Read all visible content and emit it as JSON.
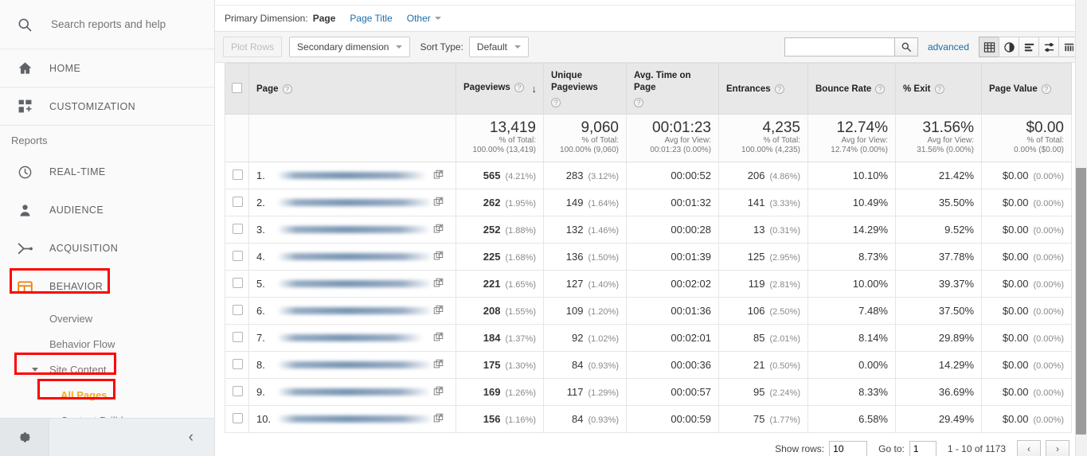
{
  "sidebar": {
    "search": {
      "placeholder": "Search reports and help",
      "value": "",
      "icon": "search-icon"
    },
    "items": [
      {
        "label": "HOME",
        "icon": "home-icon"
      },
      {
        "label": "CUSTOMIZATION",
        "icon": "customization-icon"
      }
    ],
    "section_title": "Reports",
    "reports": [
      {
        "label": "REAL-TIME",
        "icon": "clock-icon"
      },
      {
        "label": "AUDIENCE",
        "icon": "person-icon"
      },
      {
        "label": "ACQUISITION",
        "icon": "acquisition-icon"
      },
      {
        "label": "BEHAVIOR",
        "icon": "behavior-icon"
      }
    ],
    "behavior_subitems": [
      {
        "label": "Overview",
        "active": false,
        "expandable": false
      },
      {
        "label": "Behavior Flow",
        "active": false,
        "expandable": false
      },
      {
        "label": "Site Content",
        "active": false,
        "expandable": true
      },
      {
        "label": "All Pages",
        "active": true,
        "expandable": false,
        "indent": true
      },
      {
        "label": "Content Drilldown",
        "active": false,
        "expandable": false
      }
    ],
    "footer": {
      "gear_icon": "gear-icon",
      "collapse_icon": "chevron-left-icon"
    },
    "highlight_color": "#ff0000",
    "active_color": "#f9a825"
  },
  "primary_dimension": {
    "label": "Primary Dimension:",
    "active": "Page",
    "links": [
      "Page Title"
    ],
    "other": "Other"
  },
  "toolbar": {
    "plot_rows": "Plot Rows",
    "secondary_dimension": "Secondary dimension",
    "sort_type_label": "Sort Type:",
    "sort_type_value": "Default",
    "search_value": "",
    "search_icon": "search-icon",
    "advanced": "advanced",
    "views": [
      {
        "name": "table-view-icon",
        "active": true
      },
      {
        "name": "percentage-pie-view-icon",
        "active": false
      },
      {
        "name": "performance-bar-view-icon",
        "active": false
      },
      {
        "name": "comparison-view-icon",
        "active": false
      },
      {
        "name": "pivot-view-icon",
        "active": false
      }
    ]
  },
  "table": {
    "columns": [
      {
        "label": "Page",
        "help": true,
        "sorted": false
      },
      {
        "label": "Pageviews",
        "help": true,
        "sorted": true,
        "sort_dir": "↓"
      },
      {
        "label": "Unique Pageviews",
        "help": true,
        "sorted": false
      },
      {
        "label": "Avg. Time on Page",
        "help": true,
        "sorted": false
      },
      {
        "label": "Entrances",
        "help": true,
        "sorted": false
      },
      {
        "label": "Bounce Rate",
        "help": true,
        "sorted": false
      },
      {
        "label": "% Exit",
        "help": true,
        "sorted": false
      },
      {
        "label": "Page Value",
        "help": true,
        "sorted": false
      }
    ],
    "totals": [
      {
        "value": "13,419",
        "sub1": "% of Total:",
        "sub2": "100.00% (13,419)"
      },
      {
        "value": "9,060",
        "sub1": "% of Total:",
        "sub2": "100.00% (9,060)"
      },
      {
        "value": "00:01:23",
        "sub1": "Avg for View:",
        "sub2": "00:01:23 (0.00%)"
      },
      {
        "value": "4,235",
        "sub1": "% of Total:",
        "sub2": "100.00% (4,235)"
      },
      {
        "value": "12.74%",
        "sub1": "Avg for View:",
        "sub2": "12.74% (0.00%)"
      },
      {
        "value": "31.56%",
        "sub1": "Avg for View:",
        "sub2": "31.56% (0.00%)"
      },
      {
        "value": "$0.00",
        "sub1": "% of Total:",
        "sub2": "0.00% ($0.00)"
      }
    ],
    "rows": [
      {
        "rank": "1.",
        "page": "",
        "redacted": true,
        "pageviews": "565",
        "pageviews_pct": "(4.21%)",
        "unique": "283",
        "unique_pct": "(3.12%)",
        "avg_time": "00:00:52",
        "entrances": "206",
        "entrances_pct": "(4.86%)",
        "bounce": "10.10%",
        "exit": "21.42%",
        "value": "$0.00",
        "value_pct": "(0.00%)"
      },
      {
        "rank": "2.",
        "page": "",
        "redacted": true,
        "pageviews": "262",
        "pageviews_pct": "(1.95%)",
        "unique": "149",
        "unique_pct": "(1.64%)",
        "avg_time": "00:01:32",
        "entrances": "141",
        "entrances_pct": "(3.33%)",
        "bounce": "10.49%",
        "exit": "35.50%",
        "value": "$0.00",
        "value_pct": "(0.00%)"
      },
      {
        "rank": "3.",
        "page": "",
        "redacted": true,
        "pageviews": "252",
        "pageviews_pct": "(1.88%)",
        "unique": "132",
        "unique_pct": "(1.46%)",
        "avg_time": "00:00:28",
        "entrances": "13",
        "entrances_pct": "(0.31%)",
        "bounce": "14.29%",
        "exit": "9.52%",
        "value": "$0.00",
        "value_pct": "(0.00%)"
      },
      {
        "rank": "4.",
        "page": "",
        "redacted": true,
        "pageviews": "225",
        "pageviews_pct": "(1.68%)",
        "unique": "136",
        "unique_pct": "(1.50%)",
        "avg_time": "00:01:39",
        "entrances": "125",
        "entrances_pct": "(2.95%)",
        "bounce": "8.73%",
        "exit": "37.78%",
        "value": "$0.00",
        "value_pct": "(0.00%)"
      },
      {
        "rank": "5.",
        "page": "",
        "redacted": true,
        "pageviews": "221",
        "pageviews_pct": "(1.65%)",
        "unique": "127",
        "unique_pct": "(1.40%)",
        "avg_time": "00:02:02",
        "entrances": "119",
        "entrances_pct": "(2.81%)",
        "bounce": "10.00%",
        "exit": "39.37%",
        "value": "$0.00",
        "value_pct": "(0.00%)"
      },
      {
        "rank": "6.",
        "page": "",
        "redacted": true,
        "pageviews": "208",
        "pageviews_pct": "(1.55%)",
        "unique": "109",
        "unique_pct": "(1.20%)",
        "avg_time": "00:01:36",
        "entrances": "106",
        "entrances_pct": "(2.50%)",
        "bounce": "7.48%",
        "exit": "37.50%",
        "value": "$0.00",
        "value_pct": "(0.00%)"
      },
      {
        "rank": "7.",
        "page": "",
        "redacted": true,
        "pageviews": "184",
        "pageviews_pct": "(1.37%)",
        "unique": "92",
        "unique_pct": "(1.02%)",
        "avg_time": "00:02:01",
        "entrances": "85",
        "entrances_pct": "(2.01%)",
        "bounce": "8.14%",
        "exit": "29.89%",
        "value": "$0.00",
        "value_pct": "(0.00%)"
      },
      {
        "rank": "8.",
        "page": "",
        "redacted": true,
        "pageviews": "175",
        "pageviews_pct": "(1.30%)",
        "unique": "84",
        "unique_pct": "(0.93%)",
        "avg_time": "00:00:36",
        "entrances": "21",
        "entrances_pct": "(0.50%)",
        "bounce": "0.00%",
        "exit": "14.29%",
        "value": "$0.00",
        "value_pct": "(0.00%)"
      },
      {
        "rank": "9.",
        "page": "",
        "redacted": true,
        "pageviews": "169",
        "pageviews_pct": "(1.26%)",
        "unique": "117",
        "unique_pct": "(1.29%)",
        "avg_time": "00:00:57",
        "entrances": "95",
        "entrances_pct": "(2.24%)",
        "bounce": "8.33%",
        "exit": "36.69%",
        "value": "$0.00",
        "value_pct": "(0.00%)"
      },
      {
        "rank": "10.",
        "page": "",
        "redacted": true,
        "pageviews": "156",
        "pageviews_pct": "(1.16%)",
        "unique": "84",
        "unique_pct": "(0.93%)",
        "avg_time": "00:00:59",
        "entrances": "75",
        "entrances_pct": "(1.77%)",
        "bounce": "6.58%",
        "exit": "29.49%",
        "value": "$0.00",
        "value_pct": "(0.00%)"
      }
    ]
  },
  "pager": {
    "show_rows_label": "Show rows:",
    "show_rows_value": "10",
    "goto_label": "Go to:",
    "goto_value": "1",
    "range": "1 - 10 of 1173",
    "prev_icon": "chevron-left-icon",
    "next_icon": "chevron-right-icon"
  }
}
